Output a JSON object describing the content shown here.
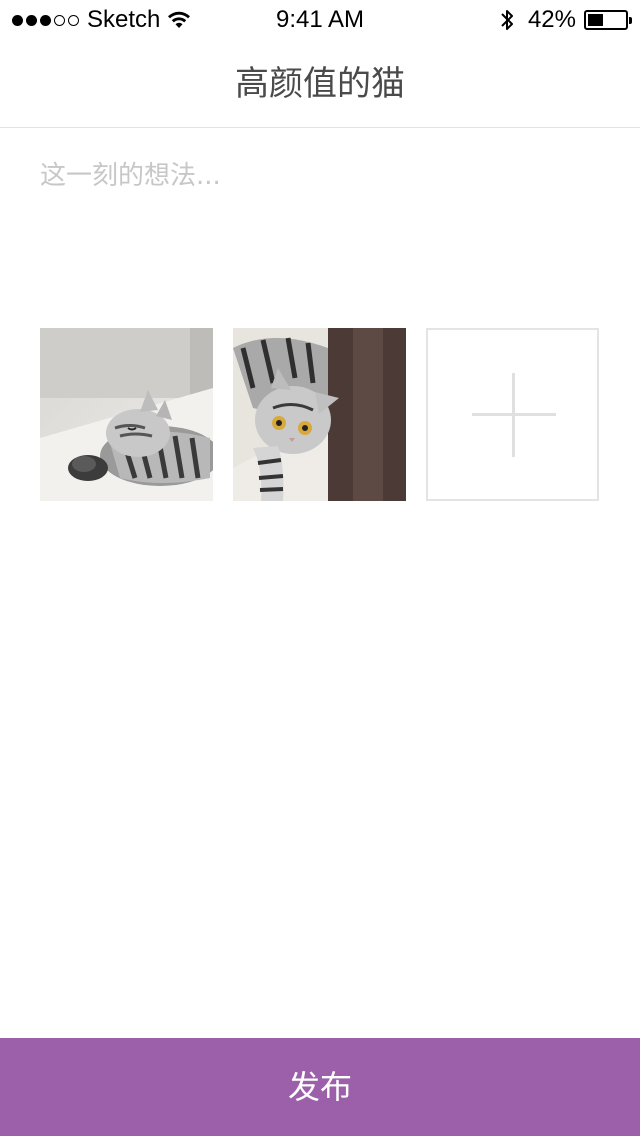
{
  "status_bar": {
    "carrier": "Sketch",
    "time": "9:41 AM",
    "battery_percent": "42%",
    "battery_level": 0.42,
    "signal_bars_filled": 3,
    "signal_bars_total": 5,
    "icons": [
      "signal-dots-icon",
      "wifi-icon",
      "bluetooth-icon",
      "battery-icon"
    ]
  },
  "nav": {
    "title": "高颜值的猫"
  },
  "composer": {
    "placeholder": "这一刻的想法...",
    "value": ""
  },
  "photos": [
    {
      "description": "sleeping-tabby-cat-photo"
    },
    {
      "description": "tabby-cat-looking-up-photo"
    }
  ],
  "add_photo": {
    "icon": "plus-icon"
  },
  "publish": {
    "label": "发布",
    "color": "#9c5faa"
  }
}
